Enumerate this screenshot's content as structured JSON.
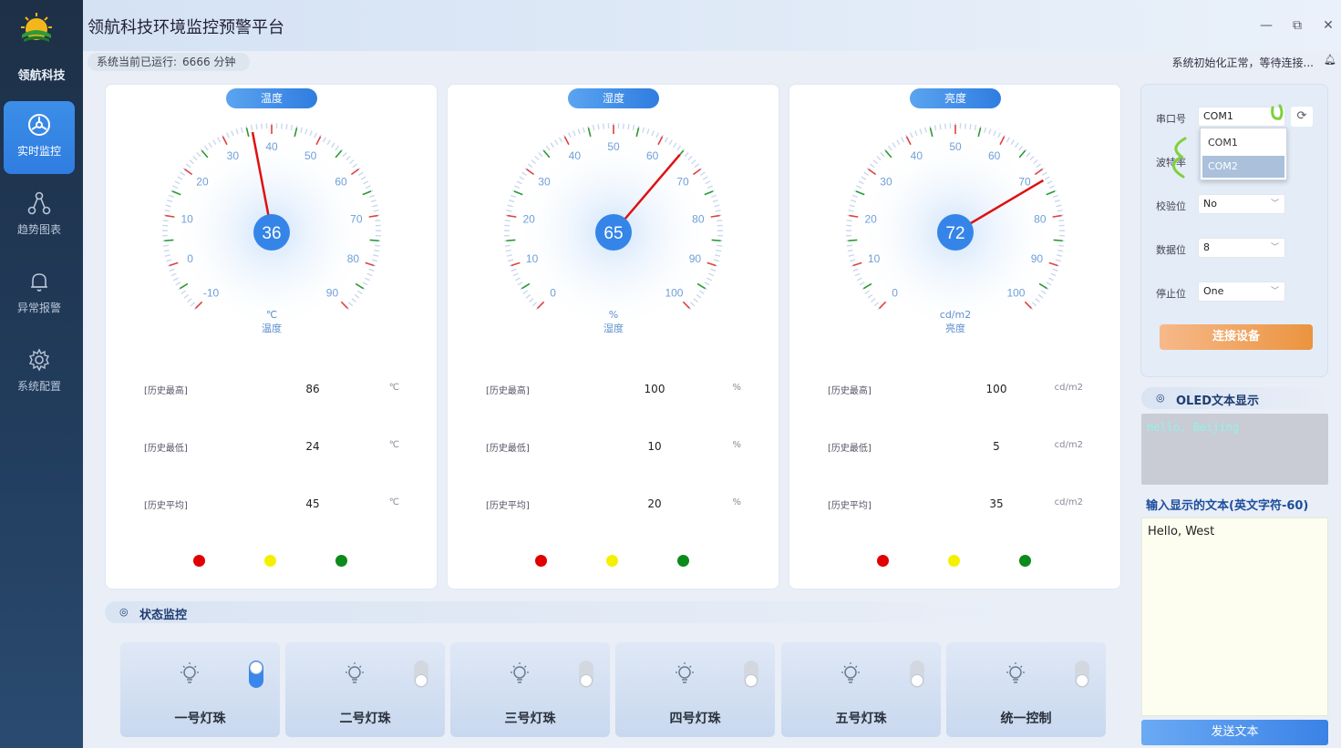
{
  "sidebar": {
    "brand": "领航科技",
    "items": [
      {
        "label": "实时监控",
        "icon": "monitor-icon",
        "active": true
      },
      {
        "label": "趋势图表",
        "icon": "trend-graph-icon",
        "active": false
      },
      {
        "label": "异常报警",
        "icon": "bell-icon",
        "active": false
      },
      {
        "label": "系统配置",
        "icon": "gear-icon",
        "active": false
      }
    ]
  },
  "window": {
    "title": "领航科技环境监控预警平台",
    "minimize": "—",
    "restore": "⧉",
    "close": "✕"
  },
  "status": {
    "uptime_label": "系统当前已运行:",
    "uptime_value": "6666 分钟",
    "message": "系统初始化正常，等待连接..."
  },
  "gauges": [
    {
      "title": "温度",
      "value": 36,
      "unit": "℃",
      "name": "温度",
      "ticks": [
        "-10",
        "0",
        "10",
        "20",
        "30",
        "40",
        "50",
        "60",
        "70",
        "80",
        "90"
      ],
      "stats": [
        {
          "label": "[历史最高]",
          "value": "86",
          "unit": "℃"
        },
        {
          "label": "[历史最低]",
          "value": "24",
          "unit": "℃"
        },
        {
          "label": "[历史平均]",
          "value": "45",
          "unit": "℃"
        }
      ]
    },
    {
      "title": "湿度",
      "value": 65,
      "unit": "%",
      "name": "湿度",
      "ticks": [
        "0",
        "10",
        "20",
        "30",
        "40",
        "50",
        "60",
        "70",
        "80",
        "90",
        "100"
      ],
      "stats": [
        {
          "label": "[历史最高]",
          "value": "100",
          "unit": "%"
        },
        {
          "label": "[历史最低]",
          "value": "10",
          "unit": "%"
        },
        {
          "label": "[历史平均]",
          "value": "20",
          "unit": "%"
        }
      ]
    },
    {
      "title": "亮度",
      "value": 72,
      "unit": "cd/m2",
      "name": "亮度",
      "ticks": [
        "0",
        "10",
        "20",
        "30",
        "40",
        "50",
        "60",
        "70",
        "80",
        "90",
        "100"
      ],
      "stats": [
        {
          "label": "[历史最高]",
          "value": "100",
          "unit": "cd/m2"
        },
        {
          "label": "[历史最低]",
          "value": "5",
          "unit": "cd/m2"
        },
        {
          "label": "[历史平均]",
          "value": "35",
          "unit": "cd/m2"
        }
      ]
    }
  ],
  "leds": {
    "colors": [
      "#e00000",
      "#f5f000",
      "#0c8a1c"
    ]
  },
  "status_panel": {
    "title": "状态监控",
    "lamps": [
      {
        "label": "一号灯珠",
        "on": true
      },
      {
        "label": "二号灯珠",
        "on": false
      },
      {
        "label": "三号灯珠",
        "on": false
      },
      {
        "label": "四号灯珠",
        "on": false
      },
      {
        "label": "五号灯珠",
        "on": false
      },
      {
        "label": "统一控制",
        "on": false
      }
    ]
  },
  "serial": {
    "port_label": "串口号",
    "port_value": "COM1",
    "port_options": [
      "COM1",
      "COM2"
    ],
    "baud_label": "波特率",
    "parity_label": "校验位",
    "parity_value": "No",
    "databits_label": "数据位",
    "databits_value": "8",
    "stopbits_label": "停止位",
    "stopbits_value": "One",
    "connect_label": "连接设备"
  },
  "oled": {
    "title": "OLED文本显示",
    "display_text": "Hello, Beijing",
    "input_label": "输入显示的文本(英文字符-60)",
    "input_text": "Hello, West",
    "send_label": "发送文本"
  }
}
